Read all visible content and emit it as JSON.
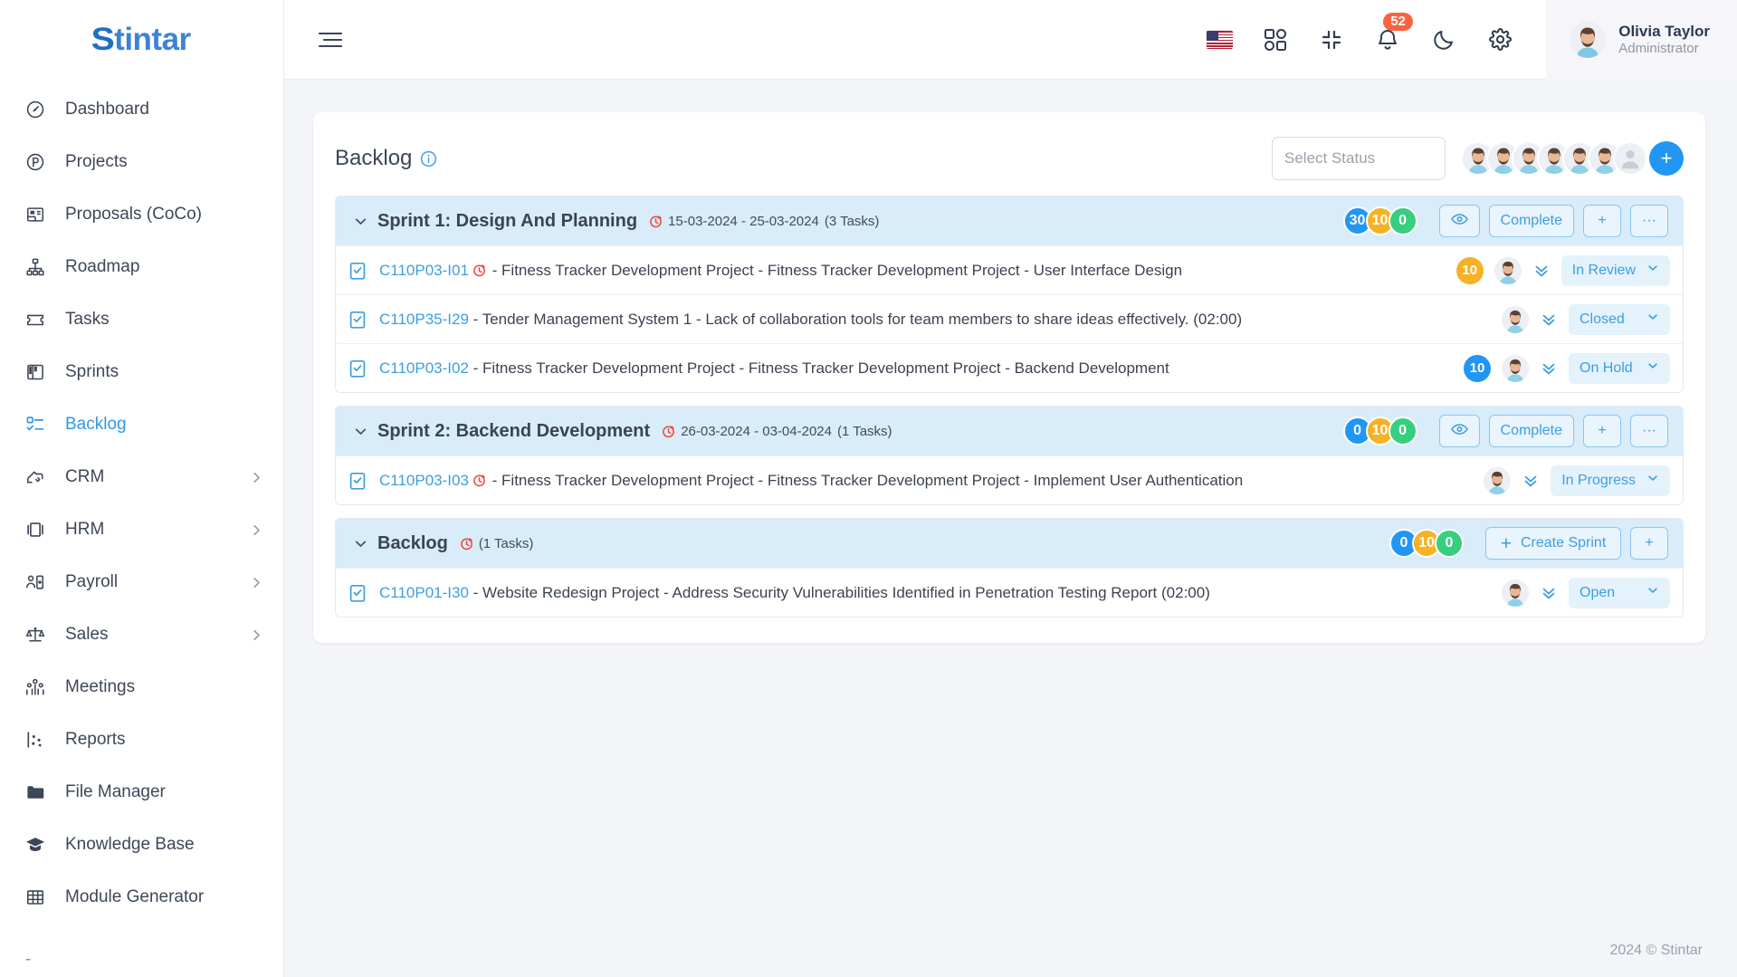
{
  "brand": {
    "name": "Stintar",
    "first_letter": "S",
    "rest": "tintar"
  },
  "sidebar": {
    "items": [
      {
        "label": "Dashboard",
        "icon": "speedometer-icon",
        "active": false,
        "expandable": false
      },
      {
        "label": "Projects",
        "icon": "project-circle-icon",
        "active": false,
        "expandable": false
      },
      {
        "label": "Proposals (CoCo)",
        "icon": "proposal-icon",
        "active": false,
        "expandable": false
      },
      {
        "label": "Roadmap",
        "icon": "sitemap-icon",
        "active": false,
        "expandable": false
      },
      {
        "label": "Tasks",
        "icon": "ticket-icon",
        "active": false,
        "expandable": false
      },
      {
        "label": "Sprints",
        "icon": "board-icon",
        "active": false,
        "expandable": false
      },
      {
        "label": "Backlog",
        "icon": "checklist-icon",
        "active": true,
        "expandable": false
      },
      {
        "label": "CRM",
        "icon": "handshake-icon",
        "active": false,
        "expandable": true
      },
      {
        "label": "HRM",
        "icon": "id-card-icon",
        "active": false,
        "expandable": true
      },
      {
        "label": "Payroll",
        "icon": "payroll-icon",
        "active": false,
        "expandable": true
      },
      {
        "label": "Sales",
        "icon": "scale-icon",
        "active": false,
        "expandable": true
      },
      {
        "label": "Meetings",
        "icon": "people-group-icon",
        "active": false,
        "expandable": false
      },
      {
        "label": "Reports",
        "icon": "scatter-chart-icon",
        "active": false,
        "expandable": false
      },
      {
        "label": "File Manager",
        "icon": "folder-icon",
        "active": false,
        "expandable": false
      },
      {
        "label": "Knowledge Base",
        "icon": "graduation-cap-icon",
        "active": false,
        "expandable": false
      },
      {
        "label": "Module Generator",
        "icon": "grid-table-icon",
        "active": false,
        "expandable": false
      }
    ],
    "trailing_dot": "-"
  },
  "topbar": {
    "menu_toggle": "hamburger-icon",
    "language_flag": "us-flag-icon",
    "apps_icon": "apps-grid-icon",
    "fullscreen_icon": "compress-icon",
    "notifications_icon": "bell-icon",
    "notifications_count": "52",
    "theme_icon": "moon-icon",
    "settings_icon": "gear-icon",
    "user": {
      "name": "Olivia Taylor",
      "role": "Administrator"
    }
  },
  "page": {
    "title": "Backlog",
    "info_icon": "info-circle-icon",
    "status_filter_placeholder": "Select Status",
    "member_avatars": 6,
    "add_member_label": "+"
  },
  "groups": [
    {
      "title": "Sprint 1: Design And Planning",
      "date_range": "15-03-2024 - 25-03-2024",
      "task_count_label": "(3 Tasks)",
      "counts": {
        "blue": "30",
        "yellow": "10",
        "green": "0"
      },
      "buttons": {
        "view": "eye-icon",
        "complete": "Complete",
        "add": "+",
        "more": "···"
      },
      "button_type": "sprint",
      "tasks": [
        {
          "key": "C110P03-I01",
          "has_clock": true,
          "text": " - Fitness Tracker Development Project - Fitness Tracker Development Project - User Interface Design",
          "estimate": "10",
          "estimate_color": "yellow",
          "status": "In Review"
        },
        {
          "key": "C110P35-I29",
          "has_clock": false,
          "text": " - Tender Management System 1 - Lack of collaboration tools for team members to share ideas effectively. (02:00)",
          "estimate": "",
          "estimate_color": "",
          "status": "Closed"
        },
        {
          "key": "C110P03-I02",
          "has_clock": false,
          "text": " - Fitness Tracker Development Project - Fitness Tracker Development Project - Backend Development",
          "estimate": "10",
          "estimate_color": "blue",
          "status": "On Hold"
        }
      ]
    },
    {
      "title": "Sprint 2: Backend Development",
      "date_range": "26-03-2024 - 03-04-2024",
      "task_count_label": "(1 Tasks)",
      "counts": {
        "blue": "0",
        "yellow": "10",
        "green": "0"
      },
      "buttons": {
        "view": "eye-icon",
        "complete": "Complete",
        "add": "+",
        "more": "···"
      },
      "button_type": "sprint",
      "tasks": [
        {
          "key": "C110P03-I03",
          "has_clock": true,
          "text": " - Fitness Tracker Development Project - Fitness Tracker Development Project - Implement User Authentication",
          "estimate": "",
          "estimate_color": "",
          "status": "In Progress"
        }
      ]
    },
    {
      "title": "Backlog",
      "date_range": "",
      "task_count_label": "(1 Tasks)",
      "counts": {
        "blue": "0",
        "yellow": "10",
        "green": "0"
      },
      "buttons": {
        "create_sprint": "Create Sprint",
        "add": "+"
      },
      "button_type": "backlog",
      "tasks": [
        {
          "key": "C110P01-I30",
          "has_clock": false,
          "text": " - Website Redesign Project - Address Security Vulnerabilities Identified in Penetration Testing Report (02:00)",
          "estimate": "",
          "estimate_color": "",
          "status": "Open"
        }
      ]
    }
  ],
  "footer": {
    "copyright": "2024 © Stintar"
  }
}
